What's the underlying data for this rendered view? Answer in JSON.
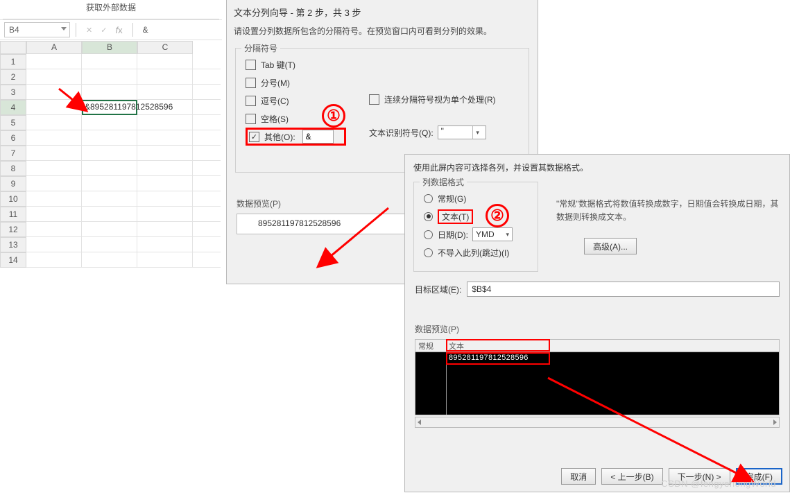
{
  "excel": {
    "ribbon_group": "获取外部数据",
    "namebox": "B4",
    "formula_amp": "&",
    "columns": [
      "A",
      "B",
      "C"
    ],
    "rows": [
      "1",
      "2",
      "3",
      "4",
      "5",
      "6",
      "7",
      "8",
      "9",
      "10",
      "11",
      "12",
      "13",
      "14"
    ],
    "cell_b4": "&895281197812528596"
  },
  "dlg1": {
    "title": "文本分列向导 - 第 2 步，共 3 步",
    "desc": "请设置分列数据所包含的分隔符号。在预览窗口内可看到分列的效果。",
    "group": "分隔符号",
    "tab": "Tab 键(T)",
    "semicolon": "分号(M)",
    "comma": "逗号(C)",
    "space": "空格(S)",
    "other": "其他(O):",
    "other_val": "&",
    "consec": "连续分隔符号视为单个处理(R)",
    "textq": "文本识别符号(Q):",
    "textq_val": "\"",
    "preview_lbl": "数据预览(P)",
    "preview_val": "895281197812528596",
    "circle": "①"
  },
  "dlg2": {
    "desc": "使用此屏内容可选择各列，并设置其数据格式。",
    "group": "列数据格式",
    "general": "常规(G)",
    "text": "文本(T)",
    "date": "日期(D):",
    "date_fmt": "YMD",
    "skip": "不导入此列(跳过)(I)",
    "hint": "\"常规\"数据格式将数值转换成数字，日期值会转换成日期，其数据则转换成文本。",
    "advanced": "高级(A)...",
    "target_lbl": "目标区域(E):",
    "target_val": "$B$4",
    "preview_lbl": "数据预览(P)",
    "col0": "常规",
    "col1": "文本",
    "preview_val": "895281197812528596",
    "cancel": "取消",
    "back": "< 上一步(B)",
    "next": "下一步(N) >",
    "finish": "完成(F)",
    "circle": "②"
  },
  "watermark": "CSDN @fengyehongWorld"
}
